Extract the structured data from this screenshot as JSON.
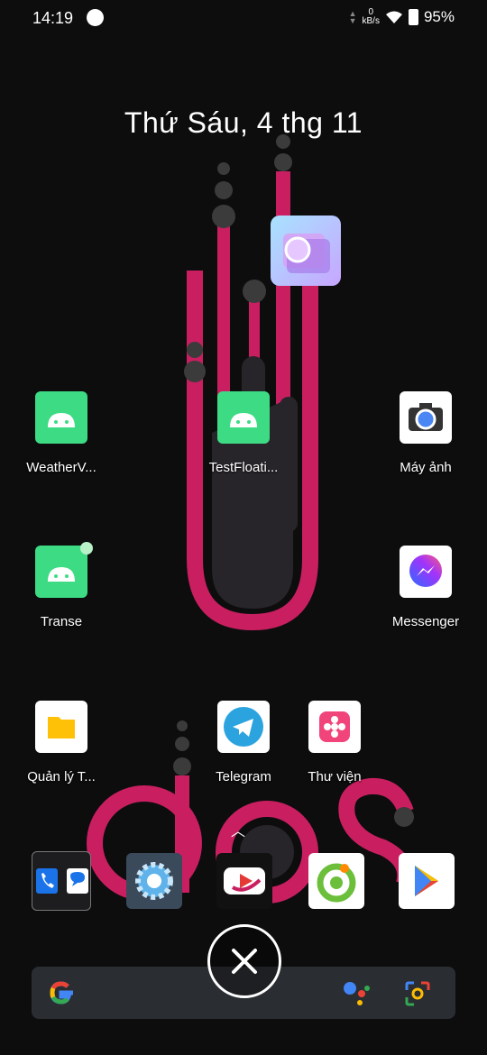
{
  "status": {
    "time": "14:19",
    "net_value": "0",
    "net_unit": "kB/s",
    "battery": "95%"
  },
  "date": "Thứ Sáu, 4 thg 11",
  "apps": {
    "weather": "WeatherV...",
    "testfloat": "TestFloati...",
    "camera": "Máy ảnh",
    "transe": "Transe",
    "messenger": "Messenger",
    "files": "Quản lý T...",
    "telegram": "Telegram",
    "gallery": "Thư viện"
  },
  "icons": {
    "floating": "floating-widget-icon",
    "phone": "phone-icon",
    "messages": "messages-icon",
    "settings": "settings-icon",
    "video": "video-player-icon",
    "coccoc": "coccoc-browser-icon",
    "play": "play-store-icon",
    "google": "google-logo-icon",
    "assistant": "assistant-icon",
    "lens": "lens-icon",
    "close": "close-icon"
  },
  "colors": {
    "accent": "#c91f60",
    "android": "#3ddc84",
    "telegram": "#2aa3df",
    "files": "#ffc107"
  }
}
